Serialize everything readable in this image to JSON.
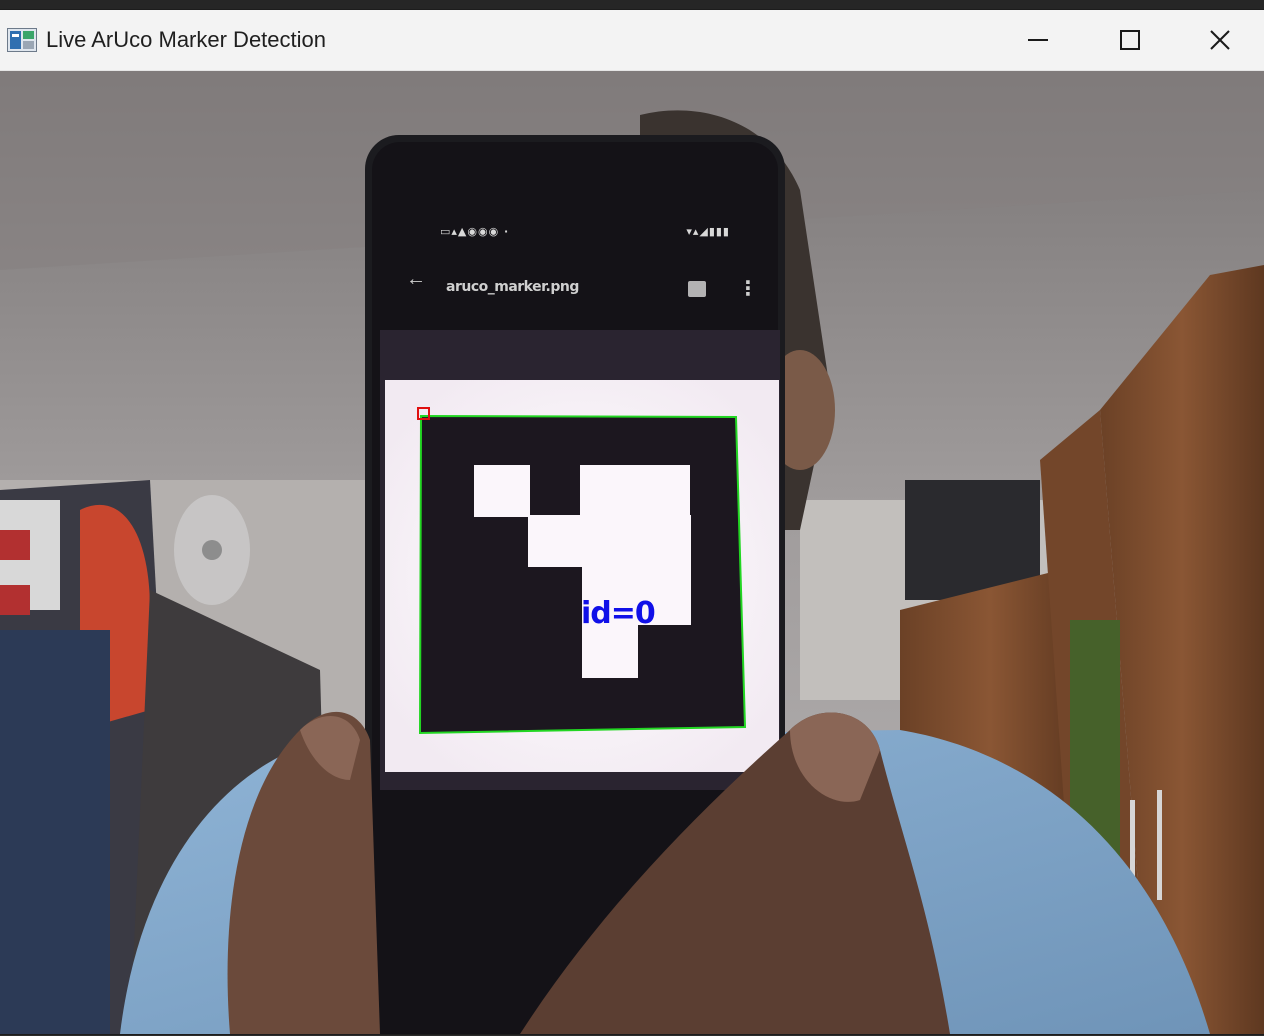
{
  "window": {
    "title": "Live ArUco Marker Detection",
    "controls": {
      "minimize": "minimize-icon",
      "maximize": "maximize-icon",
      "close": "close-icon"
    }
  },
  "overlay": {
    "marker_label": "id=0",
    "label_color": "#1010e8",
    "box_color": "#22d622",
    "corner_color": "#e01010"
  },
  "phone_screen": {
    "status_left": "▭▴▲◉◉◉ ·",
    "status_right": "▾▴◢▮▮▮",
    "back_icon": "←",
    "filename": "aruco_marker.png",
    "more_icon": "⋮"
  }
}
